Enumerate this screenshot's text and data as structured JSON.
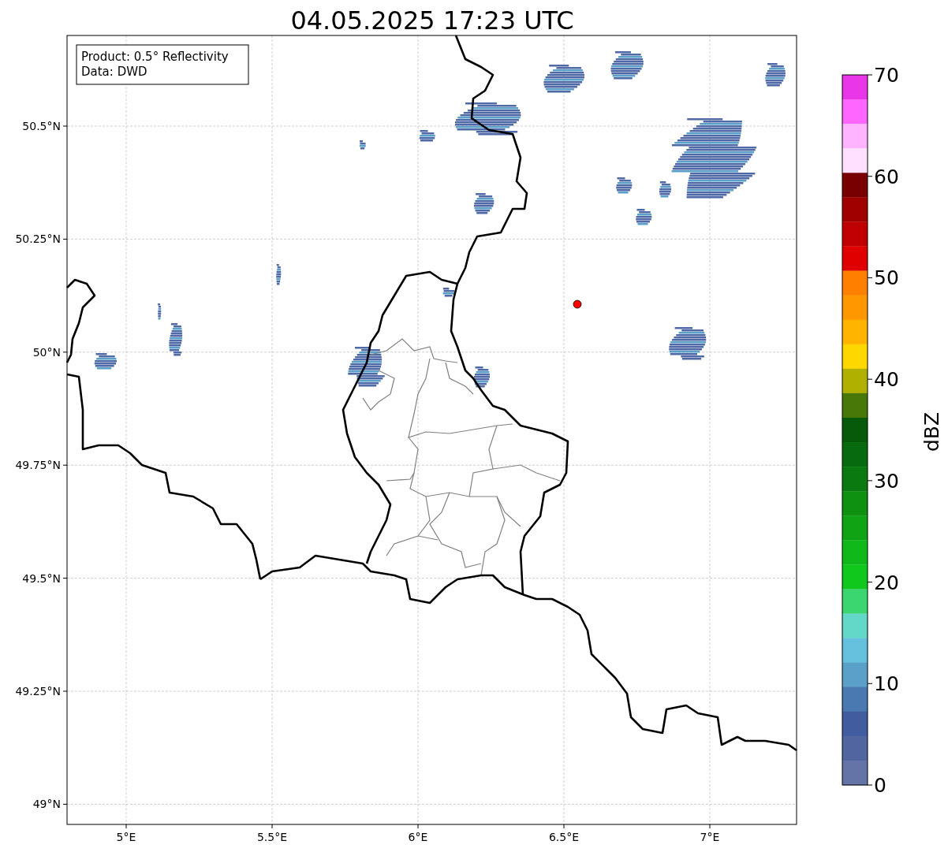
{
  "title": "04.05.2025 17:23 UTC",
  "legend": {
    "lines": [
      "Product: 0.5° Reflectivity",
      "Data: DWD"
    ]
  },
  "lat_ticks": [
    "50.5°N",
    "50.25°N",
    "50°N",
    "49.75°N",
    "49.5°N",
    "49.25°N",
    "49°N"
  ],
  "lon_ticks": [
    "5°E",
    "5.5°E",
    "6°E",
    "6.5°E",
    "7°E"
  ],
  "colorbar": {
    "label": "dBZ",
    "ticks": [
      "70",
      "60",
      "50",
      "40",
      "30",
      "20",
      "10",
      "0"
    ],
    "segments": [
      {
        "color": "#e836e8"
      },
      {
        "color": "#ff66ff"
      },
      {
        "color": "#ffb4ff"
      },
      {
        "color": "#ffe0ff"
      },
      {
        "color": "#780000"
      },
      {
        "color": "#a00000"
      },
      {
        "color": "#c00000"
      },
      {
        "color": "#e00000"
      },
      {
        "color": "#ff7f00"
      },
      {
        "color": "#ff9800"
      },
      {
        "color": "#ffb400"
      },
      {
        "color": "#ffd700"
      },
      {
        "color": "#b0b000"
      },
      {
        "color": "#487808"
      },
      {
        "color": "#065a0a"
      },
      {
        "color": "#076a0e"
      },
      {
        "color": "#0a7a10"
      },
      {
        "color": "#0e9010"
      },
      {
        "color": "#10a414"
      },
      {
        "color": "#10b81a"
      },
      {
        "color": "#10c81c"
      },
      {
        "color": "#3cd670"
      },
      {
        "color": "#64d8c8"
      },
      {
        "color": "#64c0dc"
      },
      {
        "color": "#5aa0c8"
      },
      {
        "color": "#4a78b0"
      },
      {
        "color": "#415da0"
      },
      {
        "color": "#5166a0"
      },
      {
        "color": "#6574a6"
      }
    ]
  }
}
